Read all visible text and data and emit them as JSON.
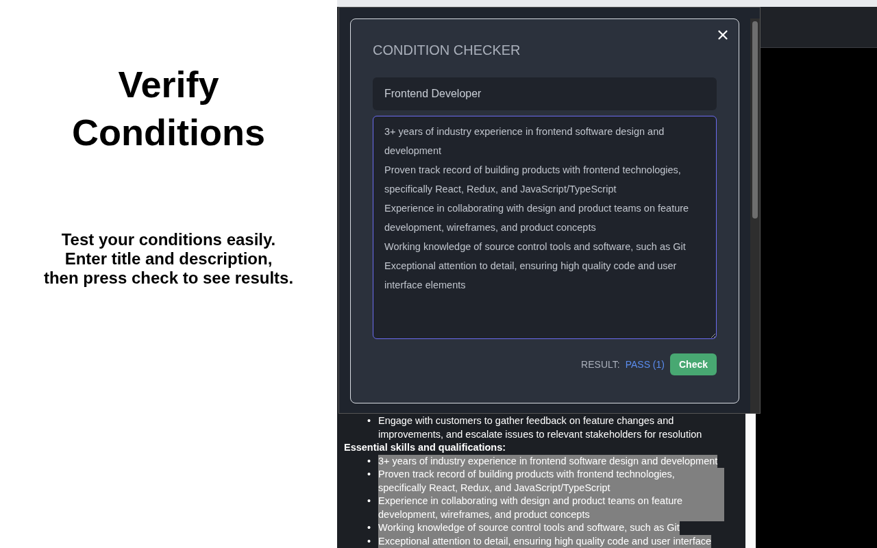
{
  "promo": {
    "heading": "Verify Conditions",
    "lines": [
      "Test your conditions easily.",
      "Enter title and description,",
      "then press check to see results."
    ]
  },
  "popup": {
    "title": "CONDITION CHECKER",
    "title_field": {
      "value": "Frontend Developer"
    },
    "description_field": {
      "value": "3+ years of industry experience in frontend software design and development\nProven track record of building products with frontend technologies, specifically React, Redux, and JavaScript/TypeScript\nExperience in collaborating with design and product teams on feature development, wireframes, and product concepts\nWorking knowledge of source control tools and software, such as Git\nExceptional attention to detail, ensuring high quality code and user interface elements"
    },
    "result_label": "RESULT:",
    "result_value": "PASS (1)",
    "check_button": "Check"
  },
  "page": {
    "items": [
      {
        "marker": "•",
        "text": "Engage with customers to gather feedback on feature changes and improvements, and escalate issues to relevant stakeholders for resolution",
        "selected": false
      }
    ],
    "section_heading": "Essential skills and qualifications:",
    "section_items": [
      {
        "marker": "•",
        "text": "3+ years of industry experience in frontend software design and development",
        "selected": true
      },
      {
        "marker": "•",
        "text": "Proven track record of building products with frontend technologies, specifically React, Redux, and JavaScript/TypeScript",
        "selected": true
      },
      {
        "marker": "•",
        "text": "Experience in collaborating with design and product teams on feature development, wireframes, and product concepts",
        "selected": true
      },
      {
        "marker": "•",
        "text": "Working knowledge of source control tools and software, such as Git",
        "selected": true
      },
      {
        "marker": "•",
        "text": "Exceptional attention to detail, ensuring high quality code and user interface",
        "selected": true
      }
    ]
  }
}
